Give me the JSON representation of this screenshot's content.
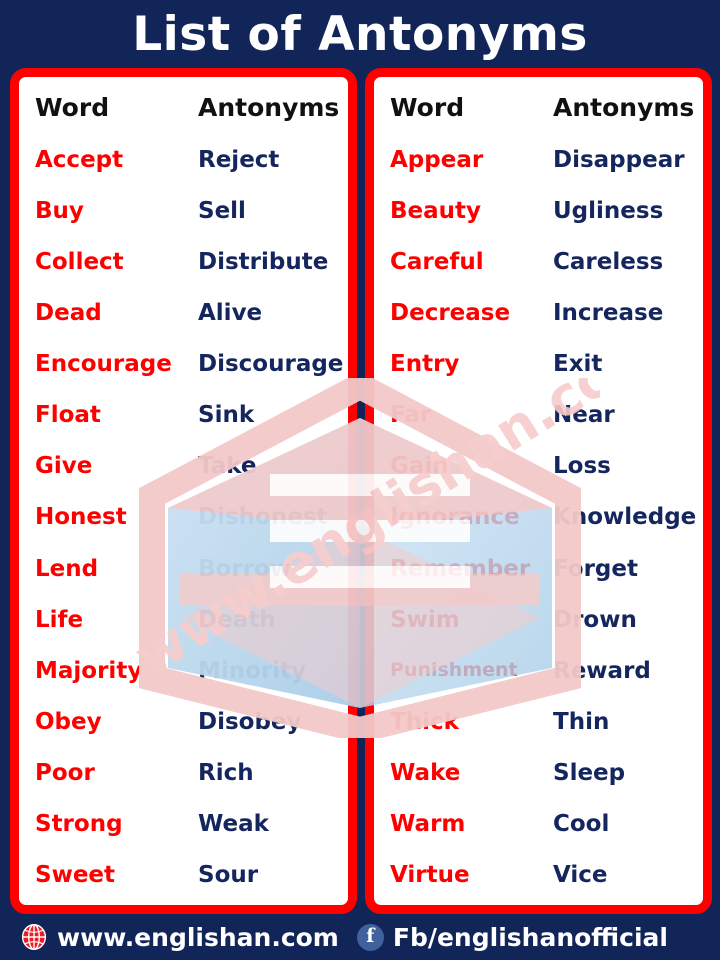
{
  "title": "List of Antonyms",
  "colors": {
    "background": "#122558",
    "panel_border": "#fe0000",
    "panel_fill": "#ffffff",
    "word_color": "#fe0000",
    "antonym_color": "#15265e",
    "header_color": "#111111",
    "title_color": "#ffffff"
  },
  "columns": {
    "word_header": "Word",
    "antonym_header": "Antonyms"
  },
  "left_panel": {
    "rows": [
      {
        "word": "Accept",
        "antonym": "Reject"
      },
      {
        "word": "Buy",
        "antonym": "Sell"
      },
      {
        "word": "Collect",
        "antonym": "Distribute"
      },
      {
        "word": "Dead",
        "antonym": "Alive"
      },
      {
        "word": "Encourage",
        "antonym": "Discourage"
      },
      {
        "word": "Float",
        "antonym": "Sink"
      },
      {
        "word": "Give",
        "antonym": "Take"
      },
      {
        "word": "Honest",
        "antonym": "Dishonest"
      },
      {
        "word": "Lend",
        "antonym": "Borrow"
      },
      {
        "word": "Life",
        "antonym": "Death"
      },
      {
        "word": "Majority",
        "antonym": "Minority"
      },
      {
        "word": "Obey",
        "antonym": "Disobey"
      },
      {
        "word": "Poor",
        "antonym": "Rich"
      },
      {
        "word": "Strong",
        "antonym": "Weak"
      },
      {
        "word": "Sweet",
        "antonym": "Sour"
      }
    ]
  },
  "right_panel": {
    "rows": [
      {
        "word": "Appear",
        "antonym": "Disappear"
      },
      {
        "word": "Beauty",
        "antonym": "Ugliness"
      },
      {
        "word": "Careful",
        "antonym": "Careless"
      },
      {
        "word": "Decrease",
        "antonym": "Increase"
      },
      {
        "word": "Entry",
        "antonym": "Exit"
      },
      {
        "word": "Far",
        "antonym": "Near"
      },
      {
        "word": "Gain",
        "antonym": "Loss"
      },
      {
        "word": "Ignorance",
        "antonym": "Knowledge"
      },
      {
        "word": "Remember",
        "antonym": "Forget"
      },
      {
        "word": "Swim",
        "antonym": "Drown"
      },
      {
        "word": "Punishment",
        "antonym": "Reward",
        "small": true
      },
      {
        "word": "Thick",
        "antonym": "Thin"
      },
      {
        "word": "Wake",
        "antonym": "Sleep"
      },
      {
        "word": "Warm",
        "antonym": "Cool"
      },
      {
        "word": "Virtue",
        "antonym": "Vice"
      }
    ]
  },
  "watermark": {
    "text": "www.englishan.com"
  },
  "footer": {
    "website": "www.englishan.com",
    "facebook": "Fb/englishanofficial",
    "globe_icon": "globe-icon",
    "facebook_icon": "facebook-icon",
    "facebook_glyph": "f"
  }
}
